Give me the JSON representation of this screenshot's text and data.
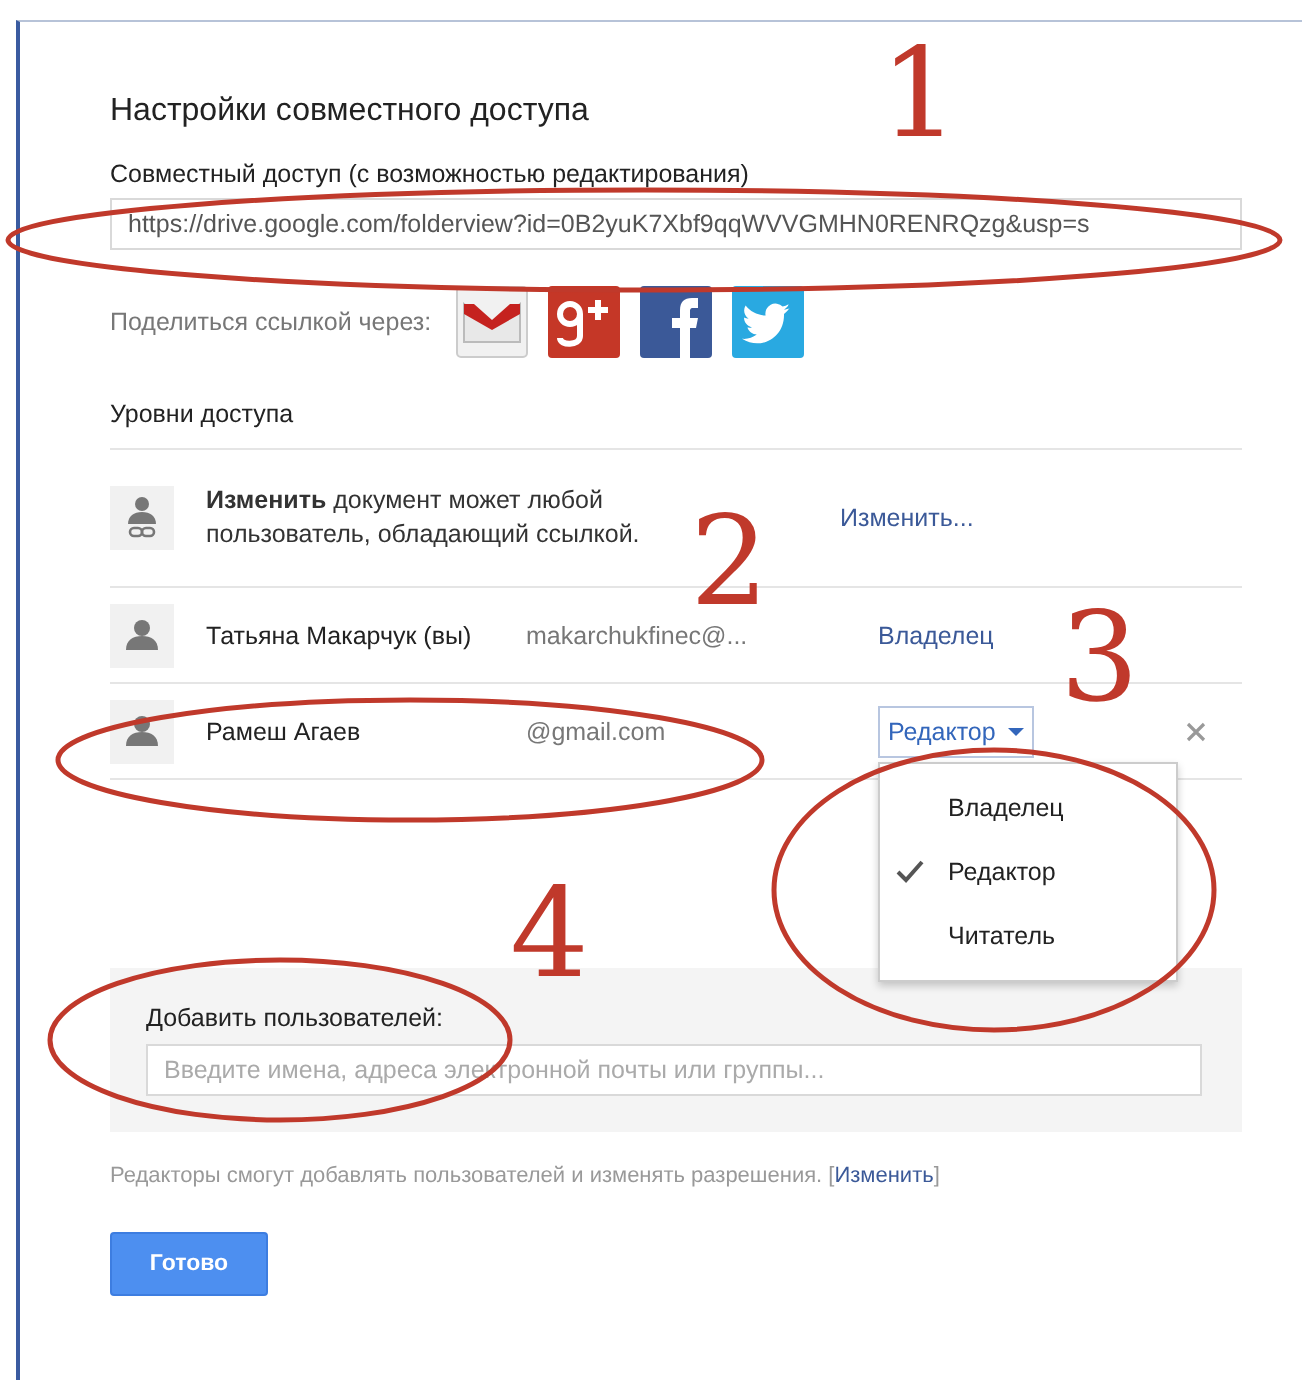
{
  "dialog": {
    "title": "Настройки совместного доступа",
    "link_label": "Совместный доступ (с возможностью редактирования)",
    "link_url": "https://drive.google.com/folderview?id=0B2yuK7Xbf9qqWVVGMHN0RENRQzg&usp=s",
    "share_label": "Поделиться ссылкой через:",
    "share_services": [
      {
        "kind": "gmail"
      },
      {
        "kind": "google-plus"
      },
      {
        "kind": "facebook"
      },
      {
        "kind": "twitter"
      }
    ],
    "access_heading": "Уровни доступа",
    "access_rows": [
      {
        "kind": "link",
        "text": "**Изменить** документ может любой пользователь, обладающий ссылкой.",
        "action": "Изменить..."
      },
      {
        "kind": "person",
        "name": "Татьяна Макарчук (вы)",
        "email": "makarchukfinec@...",
        "role": "Владелец",
        "dropdown": false,
        "removable": false
      },
      {
        "kind": "person",
        "name": "Рамеш Агаев",
        "email": "@gmail.com",
        "role": "Редактор",
        "dropdown": true,
        "removable": true
      }
    ],
    "role_menu": [
      {
        "label": "Владелец",
        "selected": false
      },
      {
        "label": "Редактор",
        "selected": true
      },
      {
        "label": "Читатель",
        "selected": false
      }
    ],
    "add_users": {
      "label": "Добавить пользователей:",
      "placeholder": "Введите имена, адреса электронной почты или группы..."
    },
    "footer": {
      "text": "Редакторы смогут добавлять пользователей и изменять разрешения.",
      "link_prefix": "[",
      "link": "Изменить",
      "link_suffix": "]"
    },
    "done_button": "Готово"
  },
  "annotations": [
    {
      "label": "1"
    },
    {
      "label": "2"
    },
    {
      "label": "3"
    },
    {
      "label": "4"
    }
  ]
}
